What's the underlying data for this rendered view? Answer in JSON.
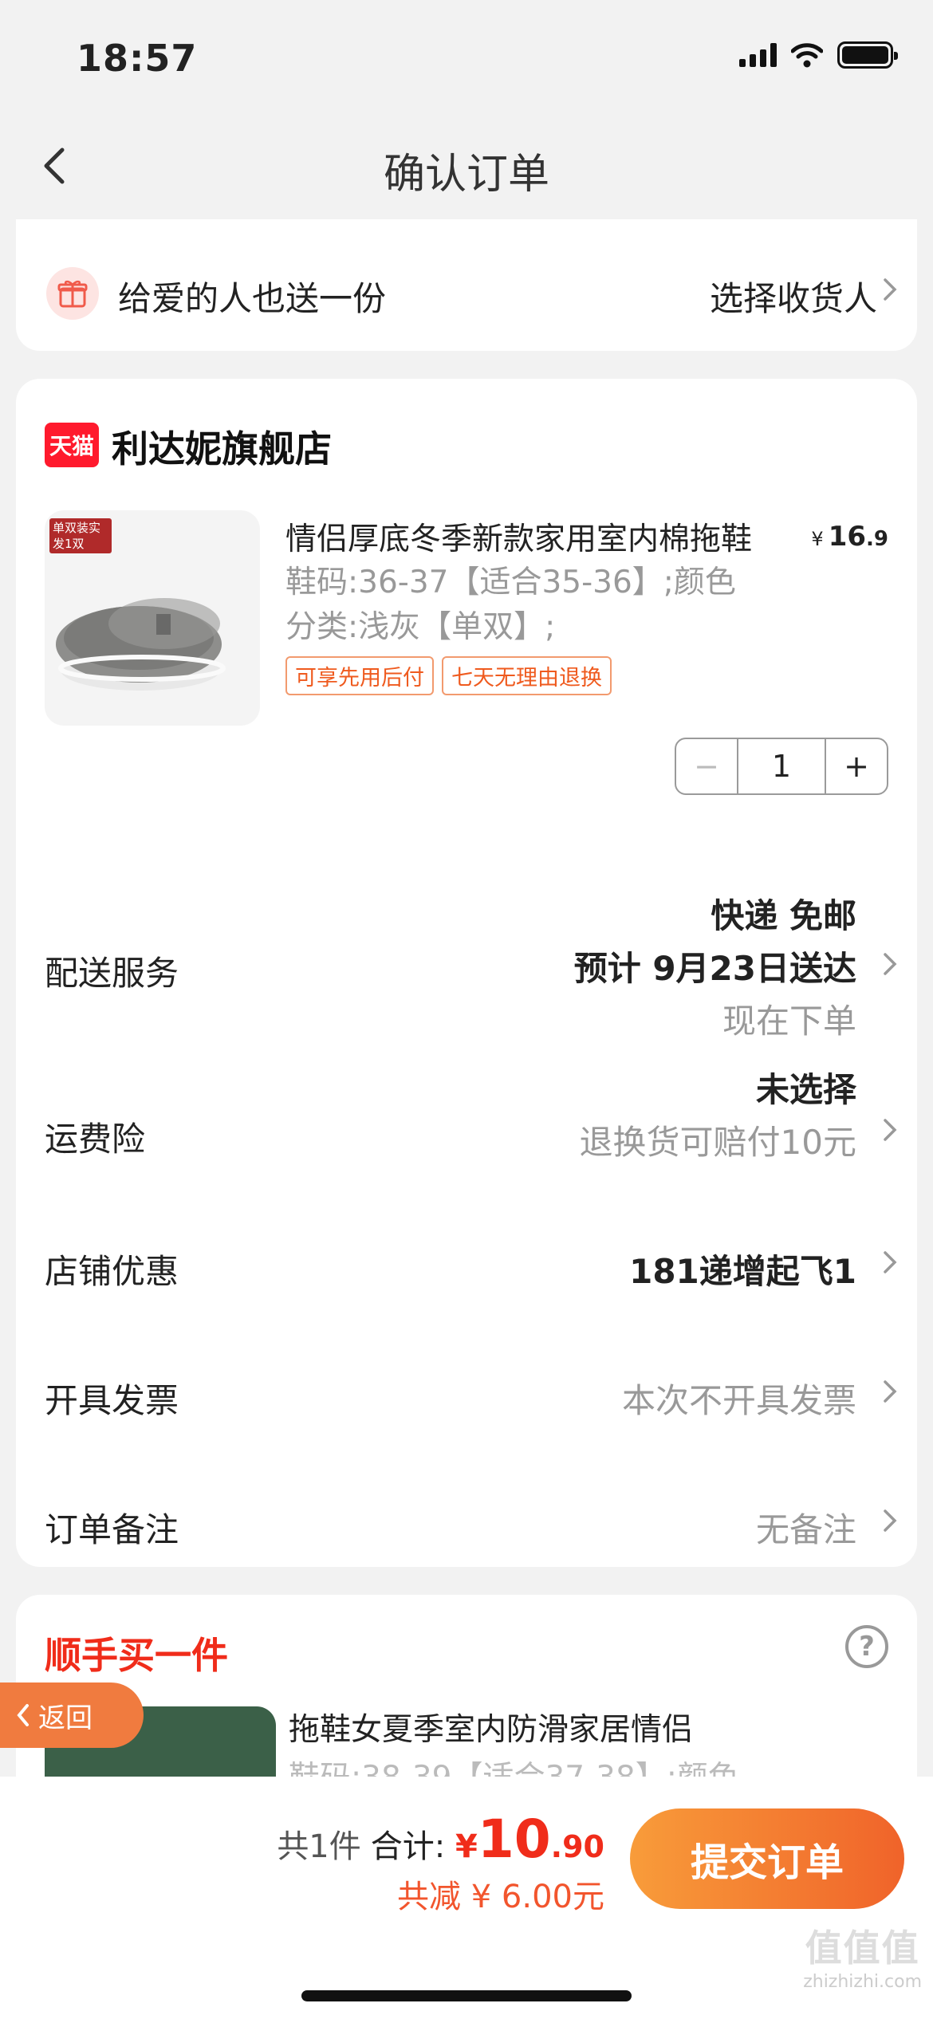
{
  "status_bar": {
    "time": "18:57"
  },
  "nav": {
    "title": "确认订单"
  },
  "gift": {
    "label": "给爱的人也送一份",
    "action": "选择收货人"
  },
  "store": {
    "badge": "天猫",
    "name": "利达妮旗舰店",
    "product": {
      "thumb_tag": "单双装实发1双",
      "title": "情侣厚底冬季新款家用室内棉拖鞋",
      "price_symbol": "¥",
      "price_int": "16",
      "price_dec": ".9",
      "sku": "鞋码:36-37【适合35-36】;颜色分类:浅灰【单双】;",
      "tags": [
        "可享先用后付",
        "七天无理由退换"
      ],
      "quantity": "1",
      "minus": "−",
      "plus": "+"
    },
    "delivery": {
      "label": "配送服务",
      "line1": "快递 免邮",
      "line2": "预计 9月23日送达",
      "line3": "现在下单"
    },
    "insurance": {
      "label": "运费险",
      "line1": "未选择",
      "line2": "退换货可赔付10元"
    },
    "discount": {
      "label": "店铺优惠",
      "value": "181递增起飞1"
    },
    "invoice": {
      "label": "开具发票",
      "value": "本次不开具发票"
    },
    "remark": {
      "label": "订单备注",
      "value": "无备注"
    }
  },
  "extra": {
    "title": "顺手买一件",
    "help": "?",
    "item_name": "拖鞋女夏季室内防滑家居情侣",
    "item_sku": "鞋码:38-39【适合37-38】;颜色"
  },
  "float_back": {
    "label": "返回"
  },
  "bottom": {
    "count": "共1件",
    "total_label": "合计:",
    "currency": "¥",
    "total_int": "10",
    "total_dec": ".90",
    "saving": "共减 ¥ 6.00元",
    "submit": "提交订单"
  },
  "watermark": {
    "logo": "值值值",
    "site": "zhizhizhi.com"
  },
  "colors": {
    "accent": "#f02c1a",
    "button_start": "#f89c3a",
    "button_end": "#f0632a",
    "tag": "#ef5a1e"
  }
}
